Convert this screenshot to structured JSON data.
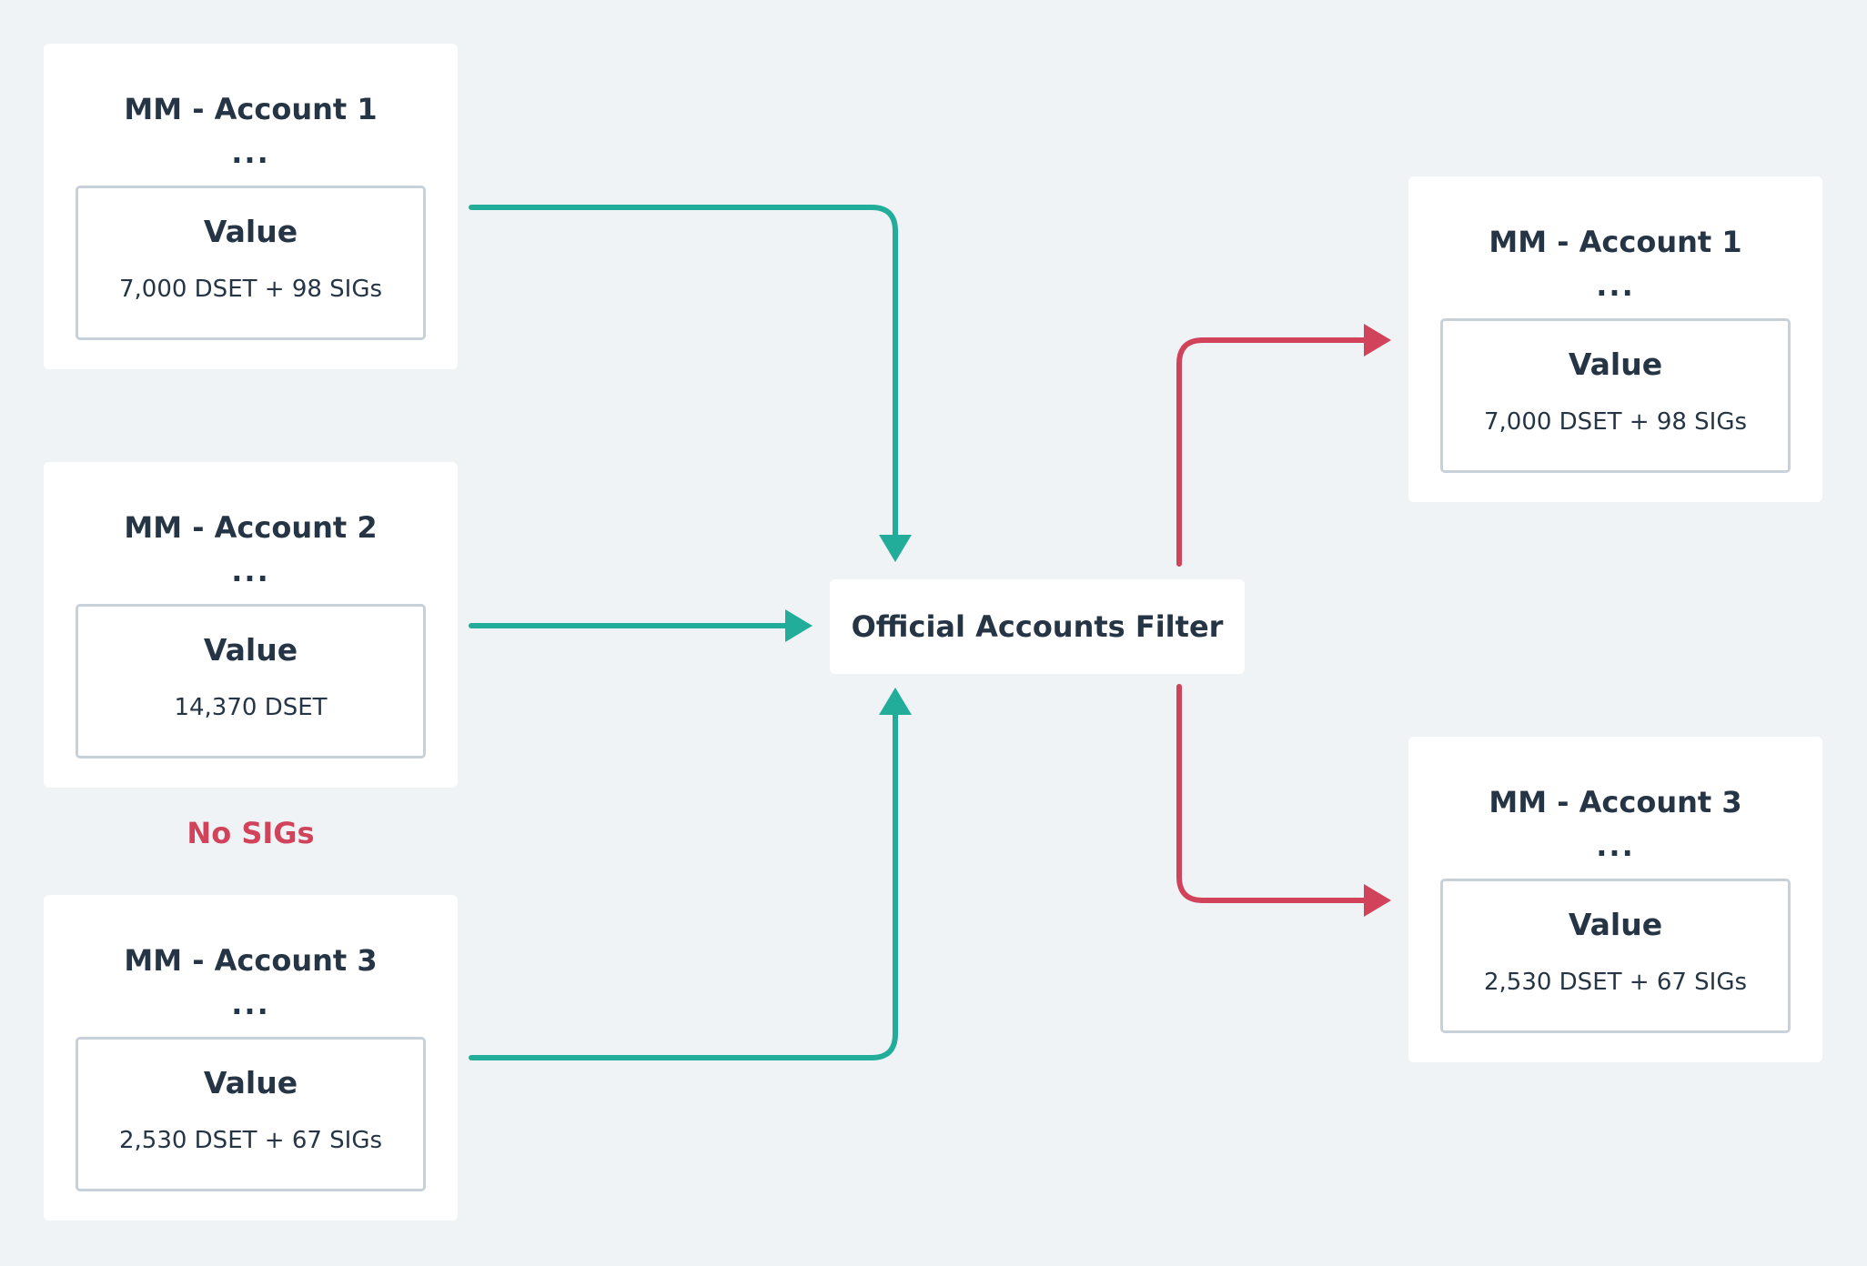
{
  "colors": {
    "background": "#eff3f6",
    "card": "#ffffff",
    "text": "#263545",
    "value_border": "#c8d1da",
    "input_arrow": "#22ad9b",
    "output_arrow": "#d0435b",
    "note": "#d0435b"
  },
  "inputs": [
    {
      "title": "MM - Account 1",
      "ellipsis": "...",
      "value_label": "Value",
      "value": "7,000 DSET + 98 SIGs"
    },
    {
      "title": "MM - Account 2",
      "ellipsis": "...",
      "value_label": "Value",
      "value": "14,370 DSET"
    },
    {
      "title": "MM - Account 3",
      "ellipsis": "...",
      "value_label": "Value",
      "value": "2,530 DSET + 67 SIGs"
    }
  ],
  "note": "No SIGs",
  "filter": {
    "label": "Official Accounts Filter"
  },
  "outputs": [
    {
      "title": "MM - Account 1",
      "ellipsis": "...",
      "value_label": "Value",
      "value": "7,000 DSET + 98 SIGs"
    },
    {
      "title": "MM - Account 3",
      "ellipsis": "...",
      "value_label": "Value",
      "value": "2,530 DSET + 67 SIGs"
    }
  ]
}
